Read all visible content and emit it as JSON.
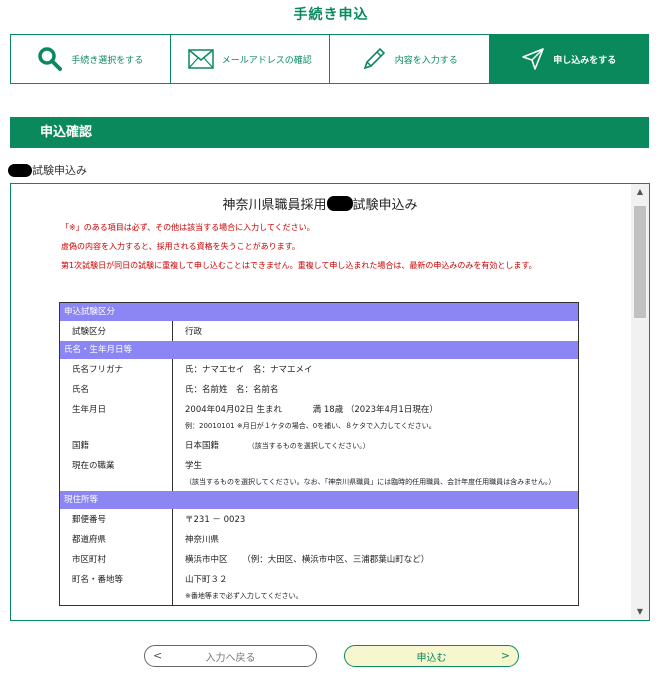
{
  "header": {
    "title": "手続き申込"
  },
  "steps": [
    {
      "label": "手続き選択をする",
      "icon": "search-icon"
    },
    {
      "label": "メールアドレスの確認",
      "icon": "mail-icon"
    },
    {
      "label": "内容を入力する",
      "icon": "pencil-icon"
    },
    {
      "label": "申し込みをする",
      "icon": "send-icon",
      "active": true
    }
  ],
  "section": {
    "title": "申込確認"
  },
  "exam_label": "試験申込み",
  "form": {
    "title_prefix": "神奈川県職員採用",
    "title_suffix": "試験申込み",
    "notices": [
      "「※」のある項目は必ず、その他は該当する場合に入力してください。",
      "虚偽の内容を入力すると、採用される資格を失うことがあります。",
      "第1次試験日が同日の試験に重複して申し込むことはできません。重複して申し込まれた場合は、最新の申込みのみを有効とします。"
    ],
    "sections": {
      "exam_category": "申込試験区分",
      "name_birth": "氏名・生年月日等",
      "address": "現住所等"
    },
    "rows": {
      "exam_type": {
        "label": "試験区分",
        "value": "行政"
      },
      "kana": {
        "label": "氏名フリガナ",
        "value": "氏：ナマエセイ　名：ナマエメイ"
      },
      "name": {
        "label": "氏名",
        "value": "氏：名前姓　名：名前名"
      },
      "birth": {
        "label": "生年月日",
        "value": "2004年04月02日 生まれ",
        "age": "満 18歳 （2023年4月1日現在）",
        "hint": "例：20010101 ※月日が１ケタの場合、0を補い、８ケタで入力してください。"
      },
      "nationality": {
        "label": "国籍",
        "value": "日本国籍",
        "hint": "（該当するものを選択してください。）"
      },
      "occupation": {
        "label": "現在の職業",
        "value": "学生",
        "hint": "（該当するものを選択してください。なお、「神奈川県職員」には臨時的任用職員、会計年度任用職員は含みません。）"
      },
      "zip": {
        "label": "郵便番号",
        "value": "〒231 － 0023"
      },
      "pref": {
        "label": "都道府県",
        "value": "神奈川県"
      },
      "city": {
        "label": "市区町村",
        "value": "横浜市中区",
        "hint": "（例：大田区、横浜市中区、三浦郡葉山町など）"
      },
      "street": {
        "label": "町名・番地等",
        "value": "山下町３２",
        "hint": "※番地等まで必ず入力してください。"
      }
    }
  },
  "buttons": {
    "back": "入力へ戻る",
    "submit": "申込む"
  },
  "colors": {
    "brand": "#0a8a5c",
    "section_header": "#8b86f3",
    "notice": "#cc0000"
  }
}
